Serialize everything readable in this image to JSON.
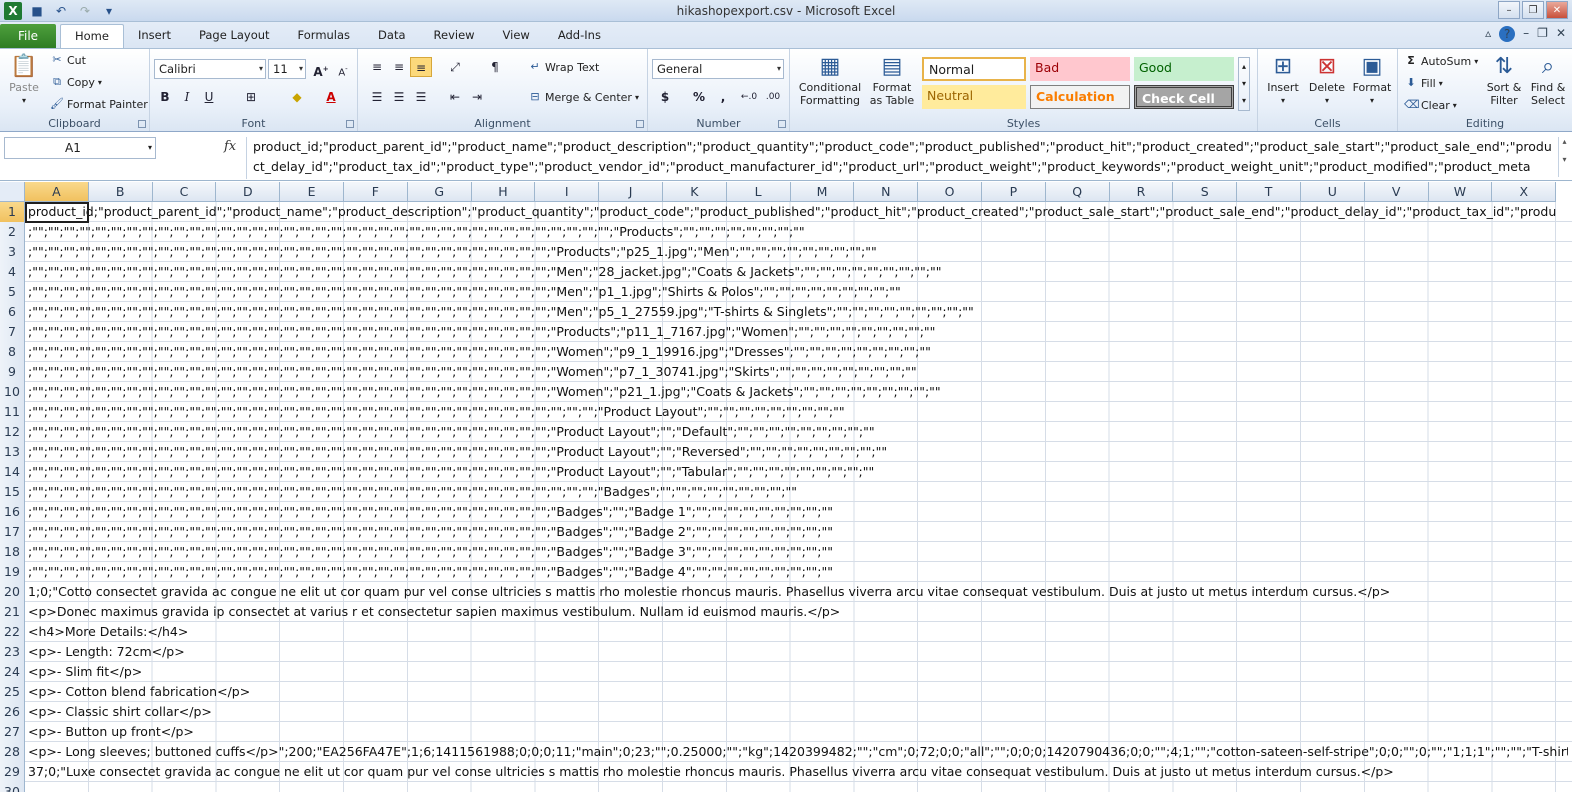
{
  "window": {
    "title": "hikashopexport.csv - Microsoft Excel"
  },
  "tabs": {
    "file": "File",
    "items": [
      "Home",
      "Insert",
      "Page Layout",
      "Formulas",
      "Data",
      "Review",
      "View",
      "Add-Ins"
    ]
  },
  "ribbon": {
    "clipboard": {
      "label": "Clipboard",
      "paste": "Paste",
      "cut": "Cut",
      "copy": "Copy",
      "format_painter": "Format Painter"
    },
    "font": {
      "label": "Font",
      "name": "Calibri",
      "size": "11"
    },
    "alignment": {
      "label": "Alignment",
      "wrap_text": "Wrap Text",
      "merge_center": "Merge & Center"
    },
    "number": {
      "label": "Number",
      "format": "General"
    },
    "styles": {
      "label": "Styles",
      "conditional": "Conditional Formatting",
      "format_table": "Format as Table",
      "normal": "Normal",
      "bad": "Bad",
      "good": "Good",
      "neutral": "Neutral",
      "calculation": "Calculation",
      "check_cell": "Check Cell"
    },
    "cells": {
      "label": "Cells",
      "insert": "Insert",
      "delete": "Delete",
      "format": "Format"
    },
    "editing": {
      "label": "Editing",
      "autosum": "AutoSum",
      "fill": "Fill",
      "clear": "Clear",
      "sort_filter": "Sort & Filter",
      "find_select": "Find & Select"
    }
  },
  "formula_bar": {
    "name_box": "A1",
    "fx": "fx",
    "content": "product_id;\"product_parent_id\";\"product_name\";\"product_description\";\"product_quantity\";\"product_code\";\"product_published\";\"product_hit\";\"product_created\";\"product_sale_start\";\"product_sale_end\";\"product_delay_id\";\"product_tax_id\";\"product_type\";\"product_vendor_id\";\"product_manufacturer_id\";\"product_url\";\"product_weight\";\"product_keywords\";\"product_weight_unit\";\"product_modified\";\"product_meta"
  },
  "columns": [
    "A",
    "B",
    "C",
    "D",
    "E",
    "F",
    "G",
    "H",
    "I",
    "J",
    "K",
    "L",
    "M",
    "N",
    "O",
    "P",
    "Q",
    "R",
    "S",
    "T",
    "U",
    "V",
    "W",
    "X"
  ],
  "rows": [
    {
      "n": "1",
      "text": "product_id;\"product_parent_id\";\"product_name\";\"product_description\";\"product_quantity\";\"product_code\";\"product_published\";\"product_hit\";\"product_created\";\"product_sale_start\";\"product_sale_end\";\"product_delay_id\";\"product_tax_id\";\"produ"
    },
    {
      "n": "2",
      "text": ";\"\";\"\";\"\";\"\";\"\";\"\";\"\";\"\";\"\";\"\";\"\";\"\";\"\";\"\";\"\";\"\";\"\";\"\";\"\";\"\";\"\";\"\";\"\";\"\";\"\";\"\";\"\";\"\";\"\";\"\";\"\";\"\";\"\";\"\";\"\";\"\";\"\";\"Products\";\"\";\"\";\"\";\"\";\"\";\"\";\"\";\"\""
    },
    {
      "n": "3",
      "text": ";\"\";\"\";\"\";\"\";\"\";\"\";\"\";\"\";\"\";\"\";\"\";\"\";\"\";\"\";\"\";\"\";\"\";\"\";\"\";\"\";\"\";\"\";\"\";\"\";\"\";\"\";\"\";\"\";\"\";\"\";\"\";\"\";\"\";\"Products\";\"p25_1.jpg\";\"Men\";\"\";\"\";\"\";\"\";\"\";\"\";\"\";\"\";\"\""
    },
    {
      "n": "4",
      "text": ";\"\";\"\";\"\";\"\";\"\";\"\";\"\";\"\";\"\";\"\";\"\";\"\";\"\";\"\";\"\";\"\";\"\";\"\";\"\";\"\";\"\";\"\";\"\";\"\";\"\";\"\";\"\";\"\";\"\";\"\";\"\";\"\";\"\";\"Men\";\"28_jacket.jpg\";\"Coats & Jackets\";\"\";\"\";\"\";\"\";\"\";\"\";\"\";\"\";\"\""
    },
    {
      "n": "5",
      "text": ";\"\";\"\";\"\";\"\";\"\";\"\";\"\";\"\";\"\";\"\";\"\";\"\";\"\";\"\";\"\";\"\";\"\";\"\";\"\";\"\";\"\";\"\";\"\";\"\";\"\";\"\";\"\";\"\";\"\";\"\";\"\";\"\";\"\";\"Men\";\"p1_1.jpg\";\"Shirts & Polos\";\"\";\"\";\"\";\"\";\"\";\"\";\"\";\"\";\"\""
    },
    {
      "n": "6",
      "text": ";\"\";\"\";\"\";\"\";\"\";\"\";\"\";\"\";\"\";\"\";\"\";\"\";\"\";\"\";\"\";\"\";\"\";\"\";\"\";\"\";\"\";\"\";\"\";\"\";\"\";\"\";\"\";\"\";\"\";\"\";\"\";\"\";\"\";\"Men\";\"p5_1_27559.jpg\";\"T-shirts & Singlets\";\"\";\"\";\"\";\"\";\"\";\"\";\"\";\"\";\"\""
    },
    {
      "n": "7",
      "text": ";\"\";\"\";\"\";\"\";\"\";\"\";\"\";\"\";\"\";\"\";\"\";\"\";\"\";\"\";\"\";\"\";\"\";\"\";\"\";\"\";\"\";\"\";\"\";\"\";\"\";\"\";\"\";\"\";\"\";\"\";\"\";\"\";\"\";\"Products\";\"p11_1_7167.jpg\";\"Women\";\"\";\"\";\"\";\"\";\"\";\"\";\"\";\"\";\"\""
    },
    {
      "n": "8",
      "text": ";\"\";\"\";\"\";\"\";\"\";\"\";\"\";\"\";\"\";\"\";\"\";\"\";\"\";\"\";\"\";\"\";\"\";\"\";\"\";\"\";\"\";\"\";\"\";\"\";\"\";\"\";\"\";\"\";\"\";\"\";\"\";\"\";\"\";\"Women\";\"p9_1_19916.jpg\";\"Dresses\";\"\";\"\";\"\";\"\";\"\";\"\";\"\";\"\";\"\""
    },
    {
      "n": "9",
      "text": ";\"\";\"\";\"\";\"\";\"\";\"\";\"\";\"\";\"\";\"\";\"\";\"\";\"\";\"\";\"\";\"\";\"\";\"\";\"\";\"\";\"\";\"\";\"\";\"\";\"\";\"\";\"\";\"\";\"\";\"\";\"\";\"\";\"\";\"Women\";\"p7_1_30741.jpg\";\"Skirts\";\"\";\"\";\"\";\"\";\"\";\"\";\"\";\"\";\"\""
    },
    {
      "n": "10",
      "text": ";\"\";\"\";\"\";\"\";\"\";\"\";\"\";\"\";\"\";\"\";\"\";\"\";\"\";\"\";\"\";\"\";\"\";\"\";\"\";\"\";\"\";\"\";\"\";\"\";\"\";\"\";\"\";\"\";\"\";\"\";\"\";\"\";\"\";\"Women\";\"p21_1.jpg\";\"Coats & Jackets\";\"\";\"\";\"\";\"\";\"\";\"\";\"\";\"\";\"\""
    },
    {
      "n": "11",
      "text": ";\"\";\"\";\"\";\"\";\"\";\"\";\"\";\"\";\"\";\"\";\"\";\"\";\"\";\"\";\"\";\"\";\"\";\"\";\"\";\"\";\"\";\"\";\"\";\"\";\"\";\"\";\"\";\"\";\"\";\"\";\"\";\"\";\"\";\"\";\"\";\"\";\"Product Layout\";\"\";\"\";\"\";\"\";\"\";\"\";\"\";\"\";\"\""
    },
    {
      "n": "12",
      "text": ";\"\";\"\";\"\";\"\";\"\";\"\";\"\";\"\";\"\";\"\";\"\";\"\";\"\";\"\";\"\";\"\";\"\";\"\";\"\";\"\";\"\";\"\";\"\";\"\";\"\";\"\";\"\";\"\";\"\";\"\";\"\";\"\";\"\";\"Product Layout\";\"\";\"Default\";\"\";\"\";\"\";\"\";\"\";\"\";\"\";\"\";\"\""
    },
    {
      "n": "13",
      "text": ";\"\";\"\";\"\";\"\";\"\";\"\";\"\";\"\";\"\";\"\";\"\";\"\";\"\";\"\";\"\";\"\";\"\";\"\";\"\";\"\";\"\";\"\";\"\";\"\";\"\";\"\";\"\";\"\";\"\";\"\";\"\";\"\";\"\";\"Product Layout\";\"\";\"Reversed\";\"\";\"\";\"\";\"\";\"\";\"\";\"\";\"\";\"\""
    },
    {
      "n": "14",
      "text": ";\"\";\"\";\"\";\"\";\"\";\"\";\"\";\"\";\"\";\"\";\"\";\"\";\"\";\"\";\"\";\"\";\"\";\"\";\"\";\"\";\"\";\"\";\"\";\"\";\"\";\"\";\"\";\"\";\"\";\"\";\"\";\"\";\"\";\"Product Layout\";\"\";\"Tabular\";\"\";\"\";\"\";\"\";\"\";\"\";\"\";\"\";\"\""
    },
    {
      "n": "15",
      "text": ";\"\";\"\";\"\";\"\";\"\";\"\";\"\";\"\";\"\";\"\";\"\";\"\";\"\";\"\";\"\";\"\";\"\";\"\";\"\";\"\";\"\";\"\";\"\";\"\";\"\";\"\";\"\";\"\";\"\";\"\";\"\";\"\";\"\";\"\";\"\";\"\";\"Badges\";\"\";\"\";\"\";\"\";\"\";\"\";\"\";\"\";\"\""
    },
    {
      "n": "16",
      "text": ";\"\";\"\";\"\";\"\";\"\";\"\";\"\";\"\";\"\";\"\";\"\";\"\";\"\";\"\";\"\";\"\";\"\";\"\";\"\";\"\";\"\";\"\";\"\";\"\";\"\";\"\";\"\";\"\";\"\";\"\";\"\";\"\";\"\";\"Badges\";\"\";\"Badge 1\";\"\";\"\";\"\";\"\";\"\";\"\";\"\";\"\";\"\""
    },
    {
      "n": "17",
      "text": ";\"\";\"\";\"\";\"\";\"\";\"\";\"\";\"\";\"\";\"\";\"\";\"\";\"\";\"\";\"\";\"\";\"\";\"\";\"\";\"\";\"\";\"\";\"\";\"\";\"\";\"\";\"\";\"\";\"\";\"\";\"\";\"\";\"\";\"Badges\";\"\";\"Badge 2\";\"\";\"\";\"\";\"\";\"\";\"\";\"\";\"\";\"\""
    },
    {
      "n": "18",
      "text": ";\"\";\"\";\"\";\"\";\"\";\"\";\"\";\"\";\"\";\"\";\"\";\"\";\"\";\"\";\"\";\"\";\"\";\"\";\"\";\"\";\"\";\"\";\"\";\"\";\"\";\"\";\"\";\"\";\"\";\"\";\"\";\"\";\"\";\"Badges\";\"\";\"Badge 3\";\"\";\"\";\"\";\"\";\"\";\"\";\"\";\"\";\"\""
    },
    {
      "n": "19",
      "text": ";\"\";\"\";\"\";\"\";\"\";\"\";\"\";\"\";\"\";\"\";\"\";\"\";\"\";\"\";\"\";\"\";\"\";\"\";\"\";\"\";\"\";\"\";\"\";\"\";\"\";\"\";\"\";\"\";\"\";\"\";\"\";\"\";\"\";\"Badges\";\"\";\"Badge 4\";\"\";\"\";\"\";\"\";\"\";\"\";\"\";\"\";\"\""
    },
    {
      "n": "20",
      "text": "1;0;\"Cotto  consectet  gravida ac  congue ne  elit ut cor  quam pur  vel conse  ultricies s  mattis rho molestie rhoncus mauris. Phasellus viverra arcu vitae consequat vestibulum. Duis at justo ut metus interdum cursus.</p>"
    },
    {
      "n": "21",
      "text": "<p>Donec  maximus  gravida ip  consectet  at varius r  et consectetur sapien maximus vestibulum. Nullam id euismod mauris.</p>"
    },
    {
      "n": "22",
      "text": "<h4>More Details:</h4>"
    },
    {
      "n": "23",
      "text": "<p>- Length: 72cm</p>"
    },
    {
      "n": "24",
      "text": "<p>- Slim fit</p>"
    },
    {
      "n": "25",
      "text": "<p>- Cotton blend fabrication</p>"
    },
    {
      "n": "26",
      "text": "<p>- Classic shirt collar</p>"
    },
    {
      "n": "27",
      "text": "<p>- Button up front</p>"
    },
    {
      "n": "28",
      "text": "<p>- Long sleeves; buttoned cuffs</p>\";200;\"EA256FA47E\";1;6;1411561988;0;0;0;11;\"main\";0;23;\"\";0.25000;\"\";\"kg\";1420399482;\"\";\"cm\";0;72;0;0;\"all\";\"\";0;0;0;1420790436;0;0;\"\";4;1;\"\";\"cotton-sateen-self-stripe\";0;0;\"\";0;\"\";\"1;1;1\";\"\";\"\";\"T-shirts & Singlets;C"
    },
    {
      "n": "29",
      "text": "37;0;\"Luxe  consectet  gravida ac  congue ne  elit ut cor  quam pur  vel conse  ultricies s  mattis rho molestie rhoncus mauris. Phasellus viverra arcu vitae consequat vestibulum. Duis at justo ut metus interdum cursus.</p>"
    },
    {
      "n": "30",
      "text": ""
    }
  ]
}
